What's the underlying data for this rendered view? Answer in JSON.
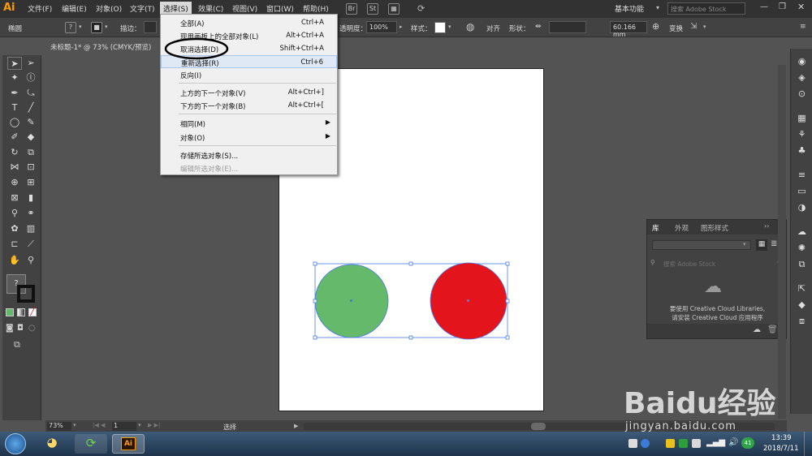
{
  "app": {
    "logo": "Ai",
    "accent": "#ff9a00"
  },
  "menubar": {
    "items": [
      "文件(F)",
      "编辑(E)",
      "对象(O)",
      "文字(T)",
      "选择(S)",
      "效果(C)",
      "视图(V)",
      "窗口(W)",
      "帮助(H)"
    ],
    "bridge": "Br",
    "stock": "St",
    "workspace": "基本功能",
    "search_placeholder": "搜索 Adobe Stock"
  },
  "controlbar": {
    "selection_label": "椭圆",
    "stroke_label": "描边：",
    "opacity_label": "透明度：",
    "opacity_value": "100%",
    "style_label": "样式：",
    "align_label": "对齐",
    "shape_label": "形状：",
    "width_value": "60.166 mm",
    "transform_label": "变换"
  },
  "document": {
    "tab_title": "未标题-1* @ 73% (CMYK/预览)"
  },
  "select_menu": {
    "items": [
      {
        "label": "全部(A)",
        "shortcut": "Ctrl+A"
      },
      {
        "label": "现用画板上的全部对象(L)",
        "shortcut": "Alt+Ctrl+A"
      },
      {
        "label": "取消选择(D)",
        "shortcut": "Shift+Ctrl+A"
      },
      {
        "label": "重新选择(R)",
        "shortcut": "Ctrl+6"
      },
      {
        "label": "反向(I)",
        "shortcut": ""
      },
      {
        "label": "上方的下一个对象(V)",
        "shortcut": "Alt+Ctrl+]"
      },
      {
        "label": "下方的下一个对象(B)",
        "shortcut": "Alt+Ctrl+["
      },
      {
        "label": "相同(M)",
        "shortcut": ""
      },
      {
        "label": "对象(O)",
        "shortcut": ""
      },
      {
        "label": "存储所选对象(S)...",
        "shortcut": ""
      },
      {
        "label": "编辑所选对象(E)...",
        "shortcut": ""
      }
    ]
  },
  "canvas": {
    "left_circle_color": "#64b96a",
    "right_circle_color": "#e3141c",
    "selection_color": "#4a7be8"
  },
  "library_panel": {
    "tabs": [
      "库",
      "外观",
      "图形样式"
    ],
    "search_placeholder": "搜索 Adobe Stock",
    "message_line1": "要使用 Creative Cloud Libraries,",
    "message_line2": "请安装 Creative Cloud 应用程序"
  },
  "statusbar": {
    "zoom": "73%",
    "page": "1",
    "tool_status": "选择"
  },
  "taskbar": {
    "time": "13:39",
    "date": "2018/7/11",
    "ai_label": "Ai"
  },
  "watermark": {
    "brand": "Baidu经验",
    "url": "jingyan.baidu.com"
  }
}
